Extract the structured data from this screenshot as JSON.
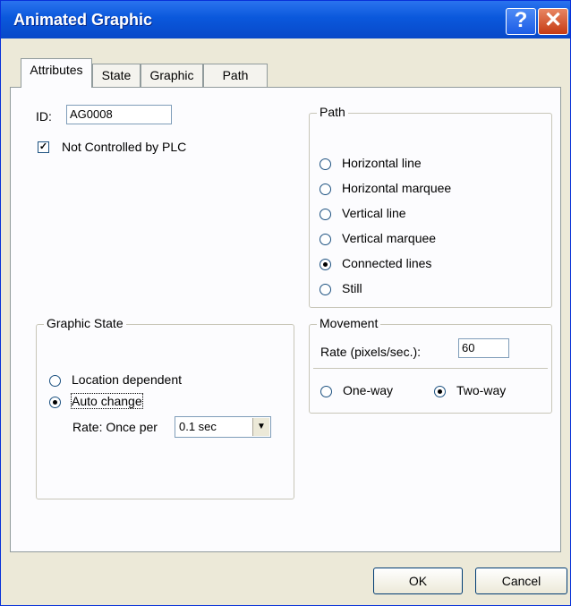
{
  "window": {
    "title": "Animated Graphic"
  },
  "tabs": [
    "Attributes",
    "State",
    "Graphic",
    "Path"
  ],
  "attributes": {
    "id_label": "ID:",
    "id_value": "AG0008",
    "not_controlled_label": "Not Controlled by PLC",
    "not_controlled_checked": true
  },
  "path_group": {
    "title": "Path",
    "options": [
      "Horizontal line",
      "Horizontal marquee",
      "Vertical line",
      "Vertical marquee",
      "Connected lines",
      "Still"
    ],
    "selected": "Connected lines"
  },
  "graphic_state": {
    "title": "Graphic State",
    "options": [
      "Location dependent",
      "Auto change"
    ],
    "selected": "Auto change",
    "rate_label": "Rate: Once per",
    "rate_value": "0.1 sec"
  },
  "movement": {
    "title": "Movement",
    "rate_label": "Rate (pixels/sec.):",
    "rate_value": "60",
    "options": [
      "One-way",
      "Two-way"
    ],
    "selected": "Two-way"
  },
  "buttons": {
    "ok": "OK",
    "cancel": "Cancel"
  },
  "icons": {
    "help": "help-icon",
    "close": "close-icon"
  },
  "colors": {
    "titlebar": "#0a58dc",
    "dialog_bg": "#ece9d8",
    "panel_bg": "#fcfcfe"
  }
}
